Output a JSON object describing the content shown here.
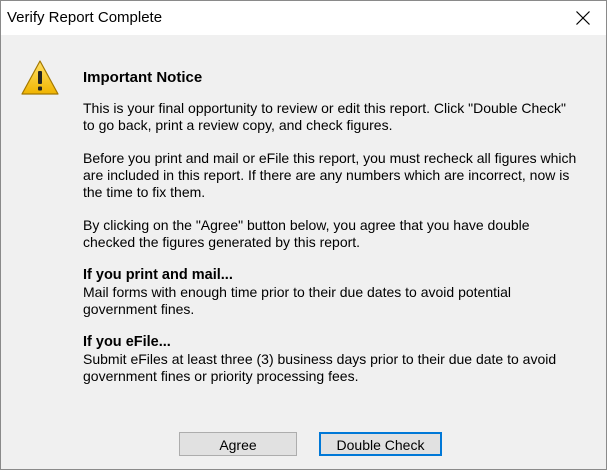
{
  "window": {
    "title": "Verify Report Complete"
  },
  "notice": {
    "title": "Important Notice",
    "paragraphs": [
      [
        "This is your final opportunity to review or edit this report. Click \"Double Check\"",
        "to go back, print a review copy, and check figures."
      ],
      [
        "Before you print and mail or eFile this report, you must recheck all figures which",
        "are included in this report.  If there are any numbers which are incorrect, now is",
        "the time to fix them."
      ],
      [
        "By clicking on the \"Agree\" button below, you agree that you have double",
        "checked the figures generated by this report."
      ]
    ]
  },
  "print_mail": {
    "heading": "If you print and mail...",
    "lines": [
      "Mail forms with enough time prior to their due dates to avoid potential",
      "government fines."
    ]
  },
  "efile": {
    "heading": "If you eFile...",
    "lines": [
      "Submit eFiles at least three (3) business days prior to their due date to avoid",
      "government fines or priority processing fees."
    ]
  },
  "buttons": {
    "agree": "Agree",
    "double_check": "Double Check"
  },
  "icons": {
    "close": "close-icon",
    "warning": "warning-icon"
  },
  "colors": {
    "dialog_bg": "#f0f0f0",
    "button_bg": "#e1e1e1",
    "focus_border": "#0078d7",
    "warning_yellow": "#f5c81e"
  }
}
